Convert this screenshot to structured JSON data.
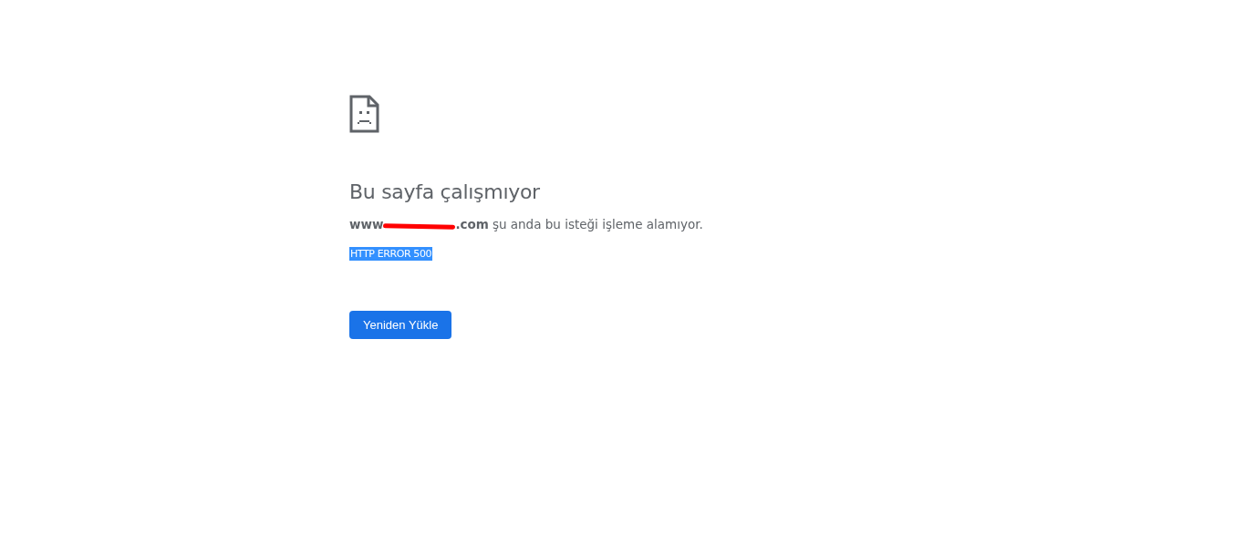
{
  "heading": "Bu sayfa çalışmıyor",
  "message": {
    "host_start": "www",
    "host_redacted": true,
    "host_end": ".com",
    "text": "şu anda bu isteği işleme alamıyor."
  },
  "error_code": {
    "text": "HTTP ERROR 500",
    "selected": true
  },
  "reload_button": {
    "label": "Yeniden Yükle"
  }
}
